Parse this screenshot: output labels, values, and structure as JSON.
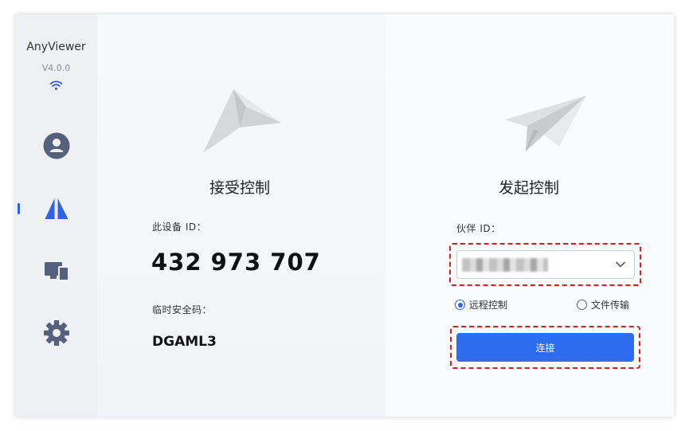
{
  "app": {
    "name": "AnyViewer",
    "version": "V4.0.0"
  },
  "sidebar": {
    "items": [
      {
        "icon": "user-icon",
        "active": false
      },
      {
        "icon": "remote-control-icon",
        "active": true
      },
      {
        "icon": "devices-icon",
        "active": false
      },
      {
        "icon": "gear-icon",
        "active": false
      }
    ]
  },
  "receive": {
    "title": "接受控制",
    "device_id_label": "此设备 ID：",
    "device_id": "432 973 707",
    "temp_code_label": "临时安全码：",
    "temp_code": "DGAML3"
  },
  "initiate": {
    "title": "发起控制",
    "partner_id_label": "伙伴 ID：",
    "partner_id_value": "",
    "modes": [
      {
        "label": "远程控制",
        "checked": true
      },
      {
        "label": "文件传输",
        "checked": false
      }
    ],
    "connect_label": "连接"
  },
  "colors": {
    "accent": "#2b6cf0",
    "highlight": "#d81e1e"
  }
}
